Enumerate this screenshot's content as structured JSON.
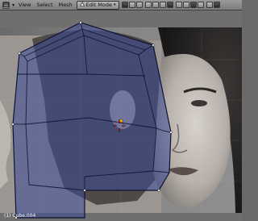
{
  "header": {
    "menus": [
      "View",
      "Select",
      "Mesh"
    ],
    "mode": "Edit Mode"
  },
  "viewport": {
    "status": "(1) Cube.004"
  },
  "colors": {
    "mesh_fill": "#3a4a9a",
    "mesh_edge": "#0d1433",
    "header_bg": "#8c8c8c"
  },
  "icons": [
    "editor-type-icon",
    "collapse-icon",
    "edit-mode-icon",
    "shading-icon",
    "pivot-icon",
    "manipulator-icon",
    "layer-icon",
    "snap-icon",
    "render-icon"
  ]
}
